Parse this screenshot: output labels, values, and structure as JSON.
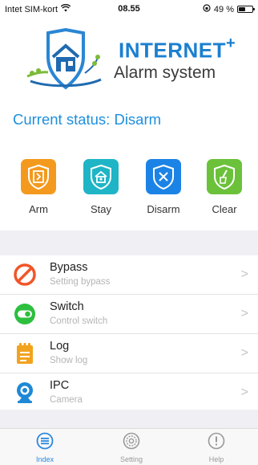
{
  "status_bar": {
    "carrier": "Intet SIM-kort",
    "time": "08.55",
    "battery_text": "49 %",
    "battery_level": 0.49
  },
  "logo": {
    "title": "INTERNET",
    "title_sup": "+",
    "subtitle": "Alarm system"
  },
  "current_status": "Current status: Disarm",
  "modes": [
    {
      "label": "Arm",
      "color": "#f39a1e",
      "icon": "arm-icon"
    },
    {
      "label": "Stay",
      "color": "#1fb5c6",
      "icon": "stay-icon"
    },
    {
      "label": "Disarm",
      "color": "#1c83e6",
      "icon": "disarm-icon"
    },
    {
      "label": "Clear",
      "color": "#6bc23a",
      "icon": "clear-icon"
    }
  ],
  "menu": [
    {
      "title": "Bypass",
      "subtitle": "Setting bypass",
      "icon": "bypass-icon"
    },
    {
      "title": "Switch",
      "subtitle": "Control switch",
      "icon": "switch-icon"
    },
    {
      "title": "Log",
      "subtitle": "Show log",
      "icon": "log-icon"
    },
    {
      "title": "IPC",
      "subtitle": "Camera",
      "icon": "camera-icon"
    }
  ],
  "tabs": [
    {
      "label": "Index",
      "active": true,
      "icon": "index-icon"
    },
    {
      "label": "Setting",
      "active": false,
      "icon": "setting-icon"
    },
    {
      "label": "Help",
      "active": false,
      "icon": "help-icon"
    }
  ],
  "colors": {
    "accent": "#1e8fdc",
    "tab_active": "#2a88e0",
    "bypass": "#f0552a",
    "switch": "#2dbf3e",
    "log": "#f2a31d",
    "ipc": "#1e88d6"
  }
}
